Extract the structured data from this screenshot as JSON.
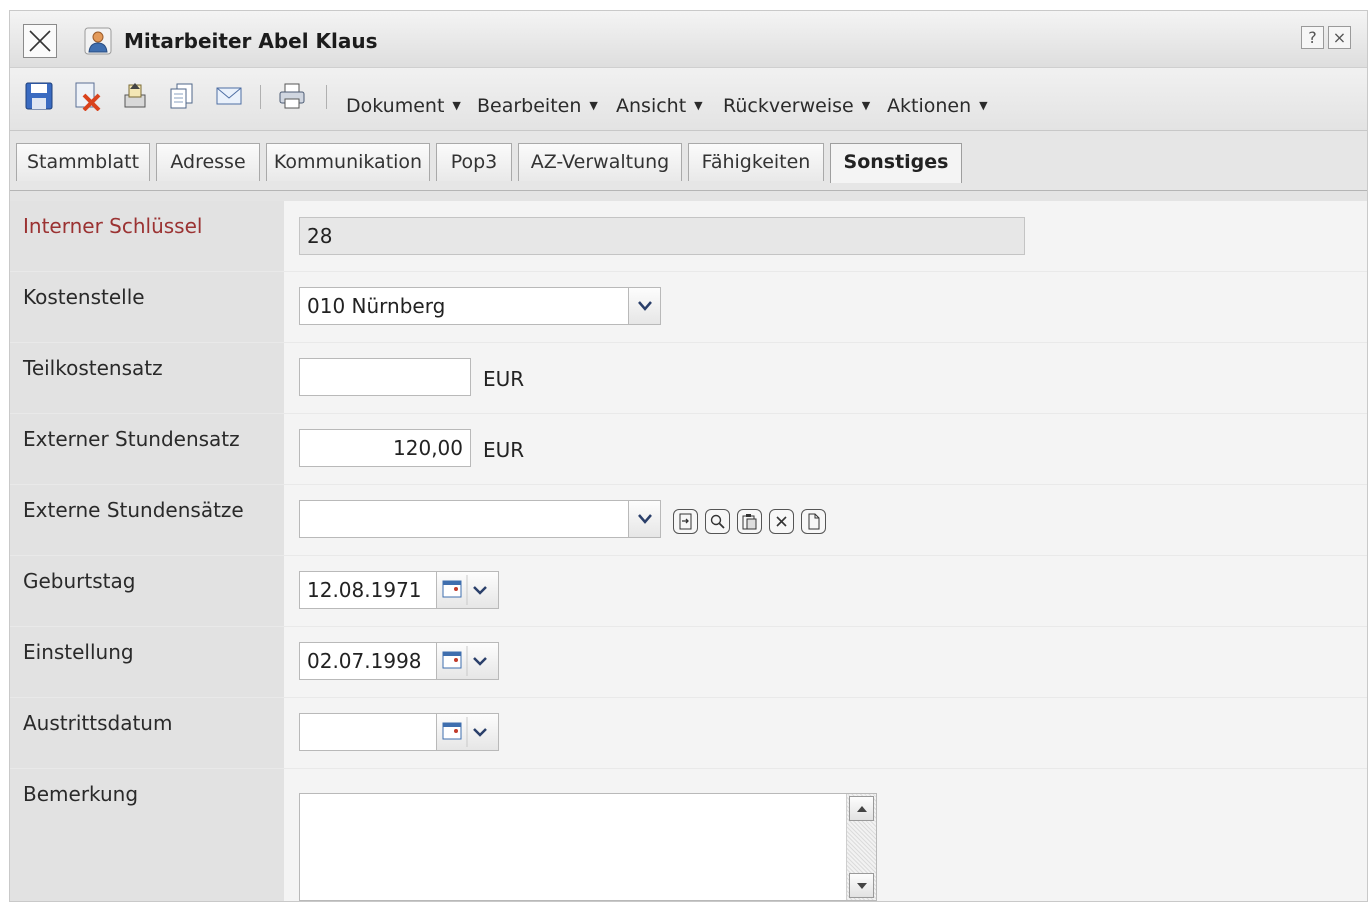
{
  "window": {
    "title": "Mitarbeiter Abel Klaus",
    "help_label": "?",
    "close_label": "×"
  },
  "toolbar": {
    "icons": [
      "save-icon",
      "delete-icon",
      "export-icon",
      "copy-icon",
      "mail-icon",
      "print-icon"
    ],
    "menus": [
      "Dokument",
      "Bearbeiten",
      "Ansicht",
      "Rückverweise",
      "Aktionen"
    ]
  },
  "tabs": [
    "Stammblatt",
    "Adresse",
    "Kommunikation",
    "Pop3",
    "AZ-Verwaltung",
    "Fähigkeiten",
    "Sonstiges"
  ],
  "active_tab": "Sonstiges",
  "form": {
    "interner_schluessel": {
      "label": "Interner Schlüssel",
      "value": "28"
    },
    "kostenstelle": {
      "label": "Kostenstelle",
      "value": "010 Nürnberg"
    },
    "teilkostensatz": {
      "label": "Teilkostensatz",
      "value": "",
      "unit": "EUR"
    },
    "externer_stundensatz": {
      "label": "Externer Stundensatz",
      "value": "120,00",
      "unit": "EUR"
    },
    "externe_stundensaetze": {
      "label": "Externe Stundensätze",
      "value": "",
      "buttons": [
        "open-icon",
        "search-icon",
        "paste-icon",
        "clear-icon",
        "new-document-icon"
      ]
    },
    "geburtstag": {
      "label": "Geburtstag",
      "value": "12.08.1971"
    },
    "einstellung": {
      "label": "Einstellung",
      "value": "02.07.1998"
    },
    "austrittsdatum": {
      "label": "Austrittsdatum",
      "value": ""
    },
    "bemerkung": {
      "label": "Bemerkung",
      "value": ""
    }
  },
  "colors": {
    "key_label": "#9b3232",
    "label_column": "#e2e2e2",
    "form_background": "#f4f4f4"
  }
}
